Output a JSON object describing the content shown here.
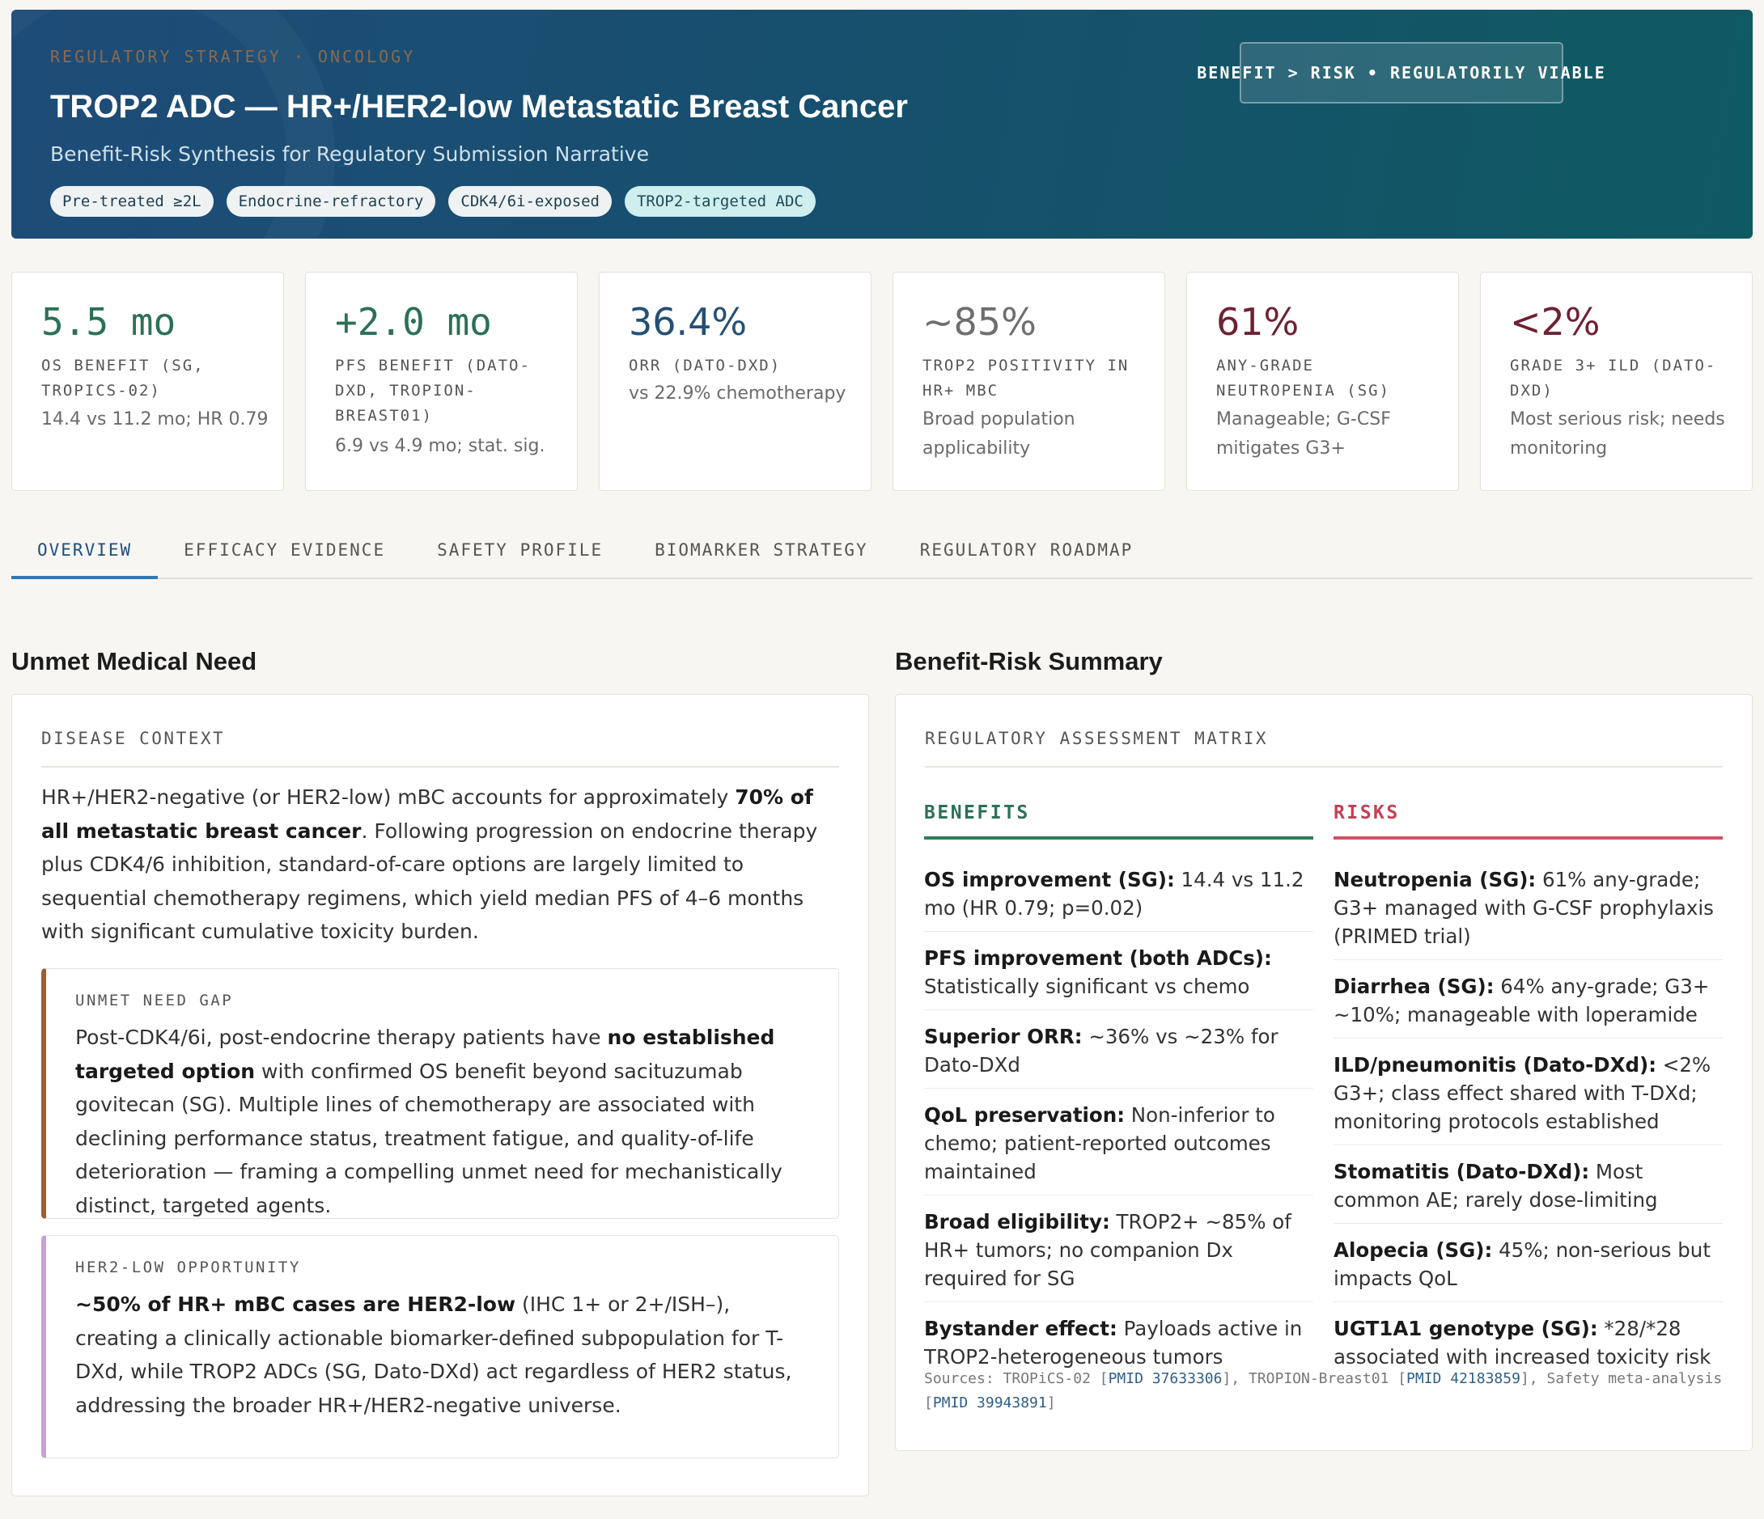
{
  "hero": {
    "eyebrow": "REGULATORY STRATEGY · ONCOLOGY",
    "title": "TROP2 ADC — HR+/HER2-low Metastatic Breast Cancer",
    "subtitle": "Benefit-Risk Synthesis for Regulatory Submission Narrative",
    "tags": [
      "Pre-treated ≥2L",
      "Endocrine-refractory",
      "CDK4/6i-exposed",
      "TROP2-targeted ADC"
    ],
    "badge": "BENEFIT > RISK • REGULATORILY VIABLE"
  },
  "kpis": [
    {
      "value": "5.5 mo",
      "label": "OS BENEFIT (SG, TROPICS-02)",
      "note": "14.4 vs 11.2 mo; HR 0.79",
      "color": "#2c7055"
    },
    {
      "value": "+2.0 mo",
      "label": "PFS BENEFIT (DATO-DXD, TROPION-BREAST01)",
      "note": "6.9 vs 4.9 mo; stat. sig.",
      "color": "#2c7055"
    },
    {
      "value": "36.4%",
      "label": "ORR (DATO-DXD)",
      "note": "vs 22.9% chemotherapy",
      "color": "#244f74"
    },
    {
      "value": "~85%",
      "label": "TROP2 POSITIVITY IN HR+ MBC",
      "note": "Broad population applicability",
      "color": "#6e6e6e"
    },
    {
      "value": "61%",
      "label": "ANY-GRADE NEUTROPENIA (SG)",
      "note": "Manageable; G-CSF mitigates G3+",
      "color": "#6e2232"
    },
    {
      "value": "<2%",
      "label": "GRADE 3+ ILD (DATO-DXD)",
      "note": "Most serious risk; needs monitoring",
      "color": "#6e2232"
    }
  ],
  "tabs": [
    "OVERVIEW",
    "EFFICACY EVIDENCE",
    "SAFETY PROFILE",
    "BIOMARKER STRATEGY",
    "REGULATORY ROADMAP"
  ],
  "unmet": {
    "section_title": "Unmet Medical Need",
    "panel_head": "DISEASE CONTEXT",
    "context": {
      "pre": "HR+/HER2-negative (or HER2-low) mBC accounts for approximately ",
      "bold": "70% of all metastatic breast cancer",
      "post": ". Following progression on endocrine therapy plus CDK4/6 inhibition, standard-of-care options are largely limited to sequential chemotherapy regimens, which yield median PFS of 4–6 months with significant cumulative toxicity burden."
    },
    "gap": {
      "head": "UNMET NEED GAP",
      "pre": "Post-CDK4/6i, post-endocrine therapy patients have ",
      "bold": "no established targeted option",
      "post": " with confirmed OS benefit beyond sacituzumab govitecan (SG). Multiple lines of chemotherapy are associated with declining performance status, treatment fatigue, and quality-of-life deterioration — framing a compelling unmet need for mechanistically distinct, targeted agents."
    },
    "her2low": {
      "head": "HER2-LOW OPPORTUNITY",
      "bold": "~50% of HR+ mBC cases are HER2-low",
      "post": " (IHC 1+ or 2+/ISH–), creating a clinically actionable biomarker-defined subpopulation for T-DXd, while TROP2 ADCs (SG, Dato-DXd) act regardless of HER2 status, addressing the broader HR+/HER2-negative universe."
    }
  },
  "summary": {
    "section_title": "Benefit-Risk Summary",
    "panel_head": "REGULATORY ASSESSMENT MATRIX",
    "benefits_head": "BENEFITS",
    "risks_head": "RISKS",
    "benefits": [
      {
        "bold": "OS improvement (SG):",
        "text": " 14.4 vs 11.2 mo (HR 0.79; p=0.02)"
      },
      {
        "bold": "PFS improvement (both ADCs):",
        "text": " Statistically significant vs chemo"
      },
      {
        "bold": "Superior ORR:",
        "text": " ~36% vs ~23% for Dato-DXd"
      },
      {
        "bold": "QoL preservation:",
        "text": " Non-inferior to chemo; patient-reported outcomes maintained"
      },
      {
        "bold": "Broad eligibility:",
        "text": " TROP2+ ~85% of HR+ tumors; no companion Dx required for SG"
      },
      {
        "bold": "Bystander effect:",
        "text": " Payloads active in TROP2-heterogeneous tumors"
      }
    ],
    "risks": [
      {
        "bold": "Neutropenia (SG):",
        "text": " 61% any-grade; G3+ managed with G-CSF prophylaxis (PRIMED trial)"
      },
      {
        "bold": "Diarrhea (SG):",
        "text": " 64% any-grade; G3+ ~10%; manageable with loperamide"
      },
      {
        "bold": "ILD/pneumonitis (Dato-DXd):",
        "text": " <2% G3+; class effect shared with T-DXd; monitoring protocols established"
      },
      {
        "bold": "Stomatitis (Dato-DXd):",
        "text": " Most common AE; rarely dose-limiting"
      },
      {
        "bold": "Alopecia (SG):",
        "text": " 45%; non-serious but impacts QoL"
      },
      {
        "bold": "UGT1A1 genotype (SG):",
        "text": " *28/*28 associated with increased toxicity risk"
      }
    ],
    "sources": {
      "prefix": "Sources: TROPiCS-02 [",
      "pmid1": "PMID 37633306",
      "mid1": "], TROPION-Breast01 [",
      "pmid2": "PMID 42183859",
      "mid2": "], Safety meta-analysis [",
      "pmid3": "PMID 39943891",
      "suffix": "]"
    }
  }
}
